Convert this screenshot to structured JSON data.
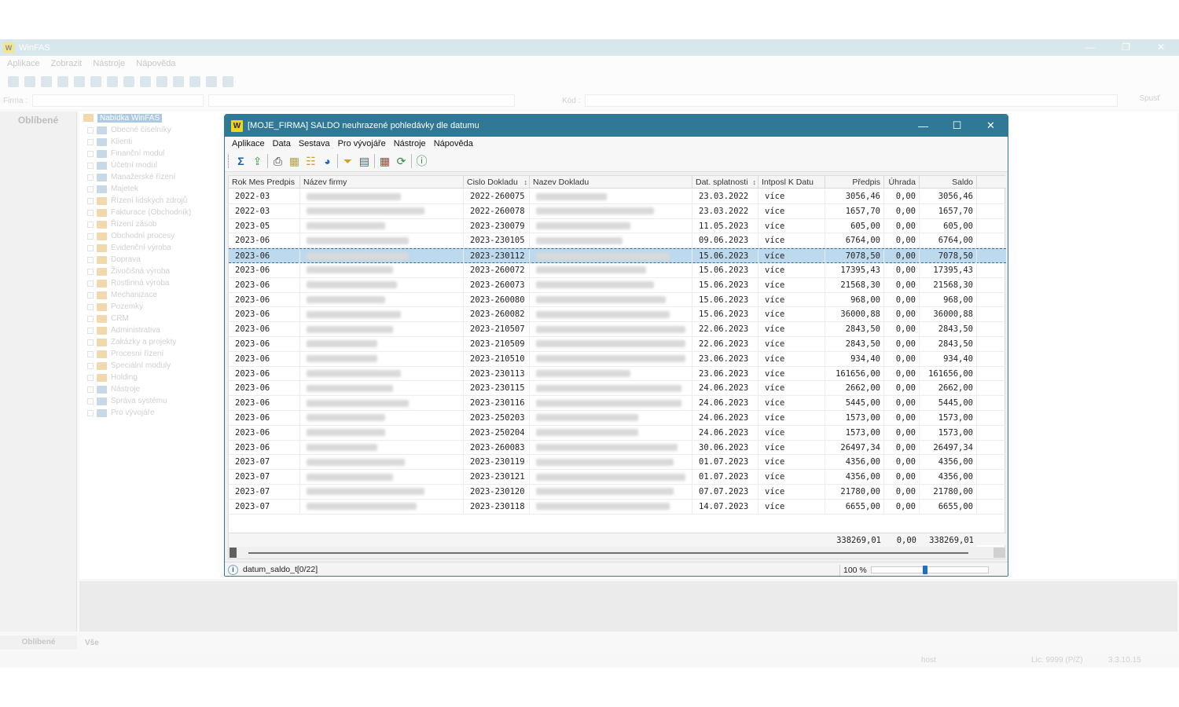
{
  "bg": {
    "title": "WinFAS",
    "menu": [
      "Aplikace",
      "Zobrazit",
      "Nástroje",
      "Nápověda"
    ],
    "firma_label": "Firma :",
    "kod_label": "Kód :",
    "spust": "Spusť",
    "left_header": "Oblíbené",
    "tree_root": "Nabídka WinFAS",
    "tree_items": [
      "Obecné číselníky",
      "Klienti",
      "Finanční modul",
      "Účetní modul",
      "Manažerské řízení",
      "Majetek",
      "Řízení lidských zdrojů",
      "Fakturace (Obchodník)",
      "Řízení zásob",
      "Obchodní procesy",
      "Evidenční výroba",
      "Doprava",
      "Živočišná výroba",
      "Rostlinná výroba",
      "Mechanizace",
      "Pozemky",
      "CRM",
      "Administrativa",
      "Zakázky a projekty",
      "Procesní řízení",
      "Speciální moduly",
      "Holding",
      "Nástroje",
      "Správa systému",
      "Pro vývojáře"
    ],
    "tab_favorites": "Oblíbené",
    "tab_all": "Vše",
    "status_host": "host",
    "status_lic": "Lic: 9999 (P/Z)",
    "status_ver": "3.3.10.15"
  },
  "dialog": {
    "logo": "W",
    "title": "[MOJE_FIRMA] SALDO neuhrazené pohledávky dle datumu",
    "menu": [
      "Aplikace",
      "Data",
      "Sestava",
      "Pro vývojáře",
      "Nástroje",
      "Nápověda"
    ],
    "status_name": "datum_saldo_t[0/22]",
    "zoom": "100 %",
    "zoom_level": 0.45
  },
  "table": {
    "headers": {
      "rok": "Rok Mes Predpis",
      "nazev_firmy": "Název firmy",
      "cislo": "Cislo Dokladu",
      "nazev_dokladu": "Nazev Dokladu",
      "datum": "Dat. splatnosti",
      "intposl": "Intposl K Datu",
      "predpis": "Předpis",
      "uhrada": "Úhrada",
      "saldo": "Saldo"
    },
    "rows": [
      {
        "rok": "2022-03",
        "cislo": "2022-260075",
        "datum": "23.03.2022",
        "intposl": "více",
        "predpis": "3056,46",
        "uhrada": "0,00",
        "saldo": "3056,46"
      },
      {
        "rok": "2022-03",
        "cislo": "2022-260078",
        "datum": "23.03.2022",
        "intposl": "více",
        "predpis": "1657,70",
        "uhrada": "0,00",
        "saldo": "1657,70"
      },
      {
        "rok": "2023-05",
        "cislo": "2023-230079",
        "datum": "11.05.2023",
        "intposl": "více",
        "predpis": "605,00",
        "uhrada": "0,00",
        "saldo": "605,00"
      },
      {
        "rok": "2023-06",
        "cislo": "2023-230105",
        "datum": "09.06.2023",
        "intposl": "více",
        "predpis": "6764,00",
        "uhrada": "0,00",
        "saldo": "6764,00"
      },
      {
        "rok": "2023-06",
        "cislo": "2023-230112",
        "datum": "15.06.2023",
        "intposl": "více",
        "predpis": "7078,50",
        "uhrada": "0,00",
        "saldo": "7078,50",
        "selected": true
      },
      {
        "rok": "2023-06",
        "cislo": "2023-260072",
        "datum": "15.06.2023",
        "intposl": "více",
        "predpis": "17395,43",
        "uhrada": "0,00",
        "saldo": "17395,43"
      },
      {
        "rok": "2023-06",
        "cislo": "2023-260073",
        "datum": "15.06.2023",
        "intposl": "více",
        "predpis": "21568,30",
        "uhrada": "0,00",
        "saldo": "21568,30"
      },
      {
        "rok": "2023-06",
        "cislo": "2023-260080",
        "datum": "15.06.2023",
        "intposl": "více",
        "predpis": "968,00",
        "uhrada": "0,00",
        "saldo": "968,00"
      },
      {
        "rok": "2023-06",
        "cislo": "2023-260082",
        "datum": "15.06.2023",
        "intposl": "více",
        "predpis": "36000,88",
        "uhrada": "0,00",
        "saldo": "36000,88"
      },
      {
        "rok": "2023-06",
        "cislo": "2023-210507",
        "datum": "22.06.2023",
        "intposl": "více",
        "predpis": "2843,50",
        "uhrada": "0,00",
        "saldo": "2843,50"
      },
      {
        "rok": "2023-06",
        "cislo": "2023-210509",
        "datum": "22.06.2023",
        "intposl": "více",
        "predpis": "2843,50",
        "uhrada": "0,00",
        "saldo": "2843,50"
      },
      {
        "rok": "2023-06",
        "cislo": "2023-210510",
        "datum": "23.06.2023",
        "intposl": "více",
        "predpis": "934,40",
        "uhrada": "0,00",
        "saldo": "934,40"
      },
      {
        "rok": "2023-06",
        "cislo": "2023-230113",
        "datum": "23.06.2023",
        "intposl": "více",
        "predpis": "161656,00",
        "uhrada": "0,00",
        "saldo": "161656,00"
      },
      {
        "rok": "2023-06",
        "cislo": "2023-230115",
        "datum": "24.06.2023",
        "intposl": "více",
        "predpis": "2662,00",
        "uhrada": "0,00",
        "saldo": "2662,00"
      },
      {
        "rok": "2023-06",
        "cislo": "2023-230116",
        "datum": "24.06.2023",
        "intposl": "více",
        "predpis": "5445,00",
        "uhrada": "0,00",
        "saldo": "5445,00"
      },
      {
        "rok": "2023-06",
        "cislo": "2023-250203",
        "datum": "24.06.2023",
        "intposl": "více",
        "predpis": "1573,00",
        "uhrada": "0,00",
        "saldo": "1573,00"
      },
      {
        "rok": "2023-06",
        "cislo": "2023-250204",
        "datum": "24.06.2023",
        "intposl": "více",
        "predpis": "1573,00",
        "uhrada": "0,00",
        "saldo": "1573,00"
      },
      {
        "rok": "2023-06",
        "cislo": "2023-260083",
        "datum": "30.06.2023",
        "intposl": "více",
        "predpis": "26497,34",
        "uhrada": "0,00",
        "saldo": "26497,34"
      },
      {
        "rok": "2023-07",
        "cislo": "2023-230119",
        "datum": "01.07.2023",
        "intposl": "více",
        "predpis": "4356,00",
        "uhrada": "0,00",
        "saldo": "4356,00"
      },
      {
        "rok": "2023-07",
        "cislo": "2023-230121",
        "datum": "01.07.2023",
        "intposl": "více",
        "predpis": "4356,00",
        "uhrada": "0,00",
        "saldo": "4356,00"
      },
      {
        "rok": "2023-07",
        "cislo": "2023-230120",
        "datum": "07.07.2023",
        "intposl": "více",
        "predpis": "21780,00",
        "uhrada": "0,00",
        "saldo": "21780,00"
      },
      {
        "rok": "2023-07",
        "cislo": "2023-230118",
        "datum": "14.07.2023",
        "intposl": "více",
        "predpis": "6655,00",
        "uhrada": "0,00",
        "saldo": "6655,00"
      }
    ],
    "totals": {
      "predpis": "338269,01",
      "uhrada": "0,00",
      "saldo": "338269,01"
    }
  },
  "toolbar_icons": [
    "sum-icon",
    "export-icon",
    "print-icon",
    "table-icon",
    "tree-icon",
    "pie-chart-icon",
    "filter-icon",
    "document-icon",
    "grid-icon",
    "refresh-icon",
    "help-icon"
  ],
  "colors": {
    "title_bar": "#2f7997",
    "selected_row": "#bcd9ee",
    "logo": "#f2d419"
  }
}
